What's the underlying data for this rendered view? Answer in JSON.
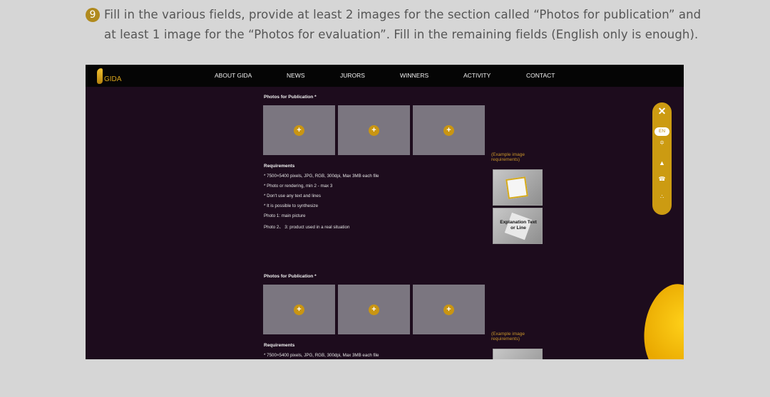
{
  "instruction": {
    "step_number": "9",
    "line1": "Fill in the various fields, provide at least 2 images for the section called  “Photos for publication”  and",
    "line2": "at least 1 image for the  “Photos for evaluation”. Fill in the remaining fields (English only is enough)."
  },
  "site": {
    "logo_text": "GIDA",
    "nav": [
      "ABOUT GIDA",
      "NEWS",
      "JURORS",
      "WINNERS",
      "ACTIVITY",
      "CONTACT"
    ]
  },
  "sections": [
    {
      "title": "Photos for Publication *",
      "upload_plus": "+",
      "requirements_title": "Requirements",
      "requirements": [
        "* 7500×5400 pixels, JPG, RGB, 300dpi, Max 3MB each file",
        "* Photo or rendering, min 2 - max 3",
        "* Don't use any text and lines",
        "* It is possible to synthesize",
        "Photo 1: main picture",
        "Photo 2、 3: product used in a real situation"
      ],
      "example_caption": "(Example image requirements)",
      "example_text": "Explanation Text or Line"
    },
    {
      "title": "Photos for Publication *",
      "upload_plus": "+",
      "requirements_title": "Requirements",
      "requirements": [
        "* 7500×5400 pixels, JPG, RGB, 300dpi, Max 3MB each file"
      ],
      "example_caption": "(Example image requirements)"
    }
  ],
  "floating_bar": {
    "close": "✕",
    "lang": "EN",
    "zh": "中",
    "user": "▲",
    "phone": "☎",
    "share": "∴"
  },
  "colors": {
    "accent_gold": "#cc9b12",
    "page_bg": "#1d0c1d",
    "nav_bg": "#050505",
    "upload_box": "#7b7680"
  }
}
